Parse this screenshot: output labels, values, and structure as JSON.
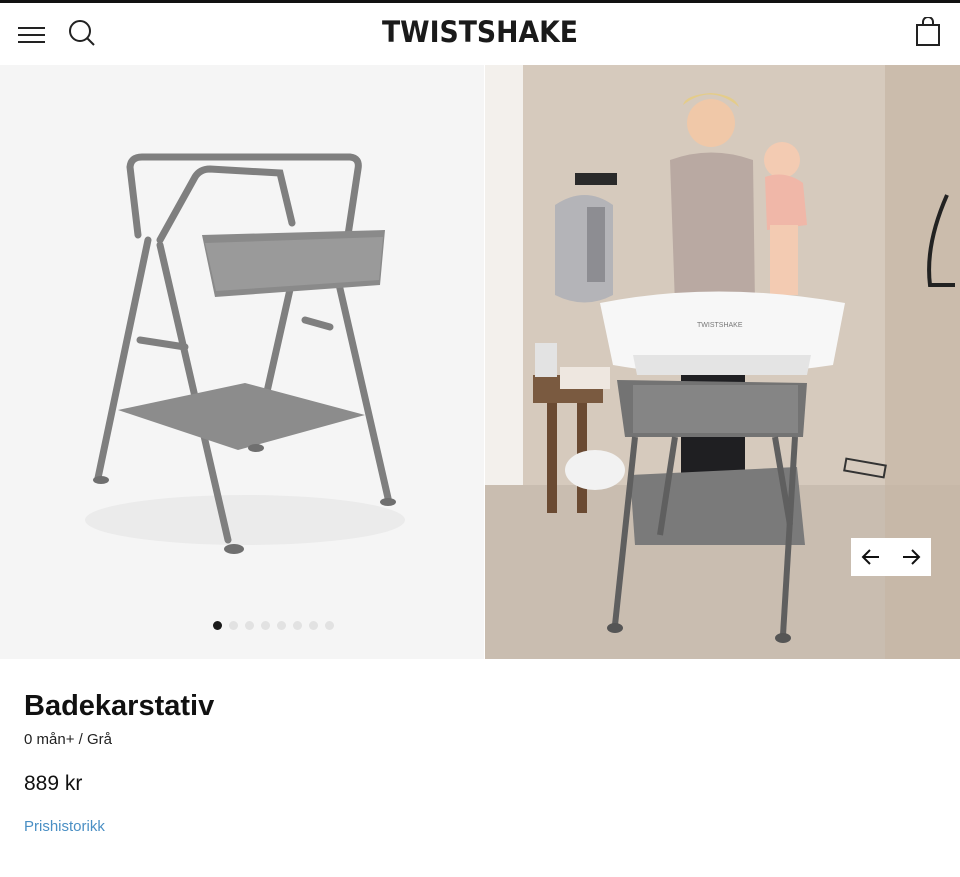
{
  "header": {
    "brand": "TWISTSHAKE"
  },
  "product": {
    "title": "Badekarstativ",
    "variant": "0 mån+ / Grå",
    "price": "889 kr",
    "price_history_link": "Prishistorikk",
    "bath_brand_print": "TWISTSHAKE"
  },
  "gallery": {
    "slide_count": 8,
    "active_slide": 1
  },
  "colors": {
    "link": "#4a8fc4",
    "frame_gray": "#7f7f7f",
    "dot_active": "#1a1a1a",
    "dot_inactive": "#e2e2e2"
  },
  "icons": [
    "menu-icon",
    "search-icon",
    "shopping-bag-icon",
    "arrow-left-icon",
    "arrow-right-icon"
  ]
}
